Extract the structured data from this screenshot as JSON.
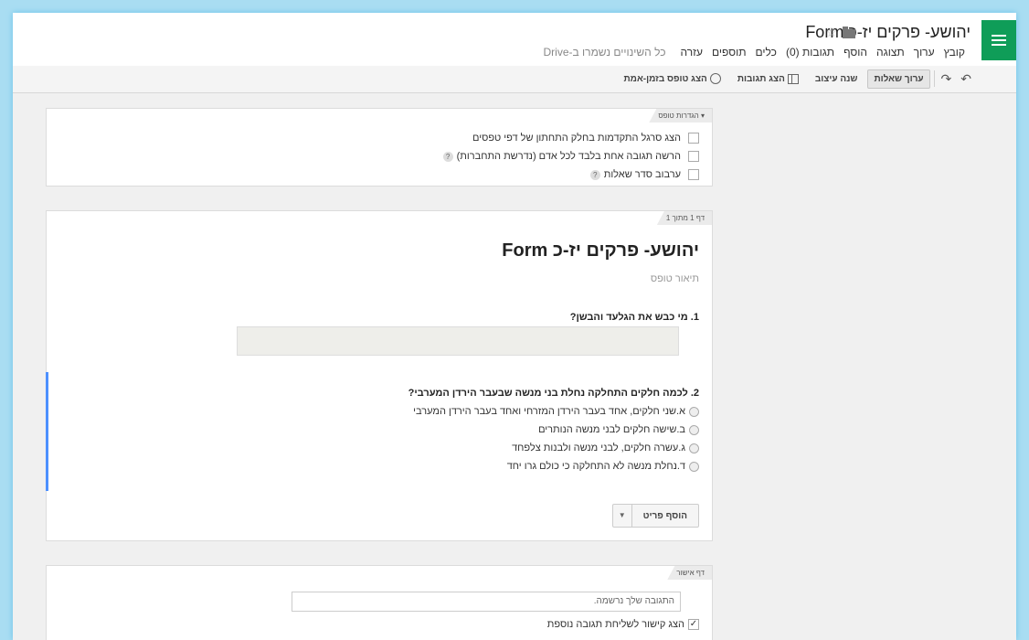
{
  "header": {
    "title": "יהושע- פרקים יז-כ Form",
    "menu": [
      "קובץ",
      "ערוך",
      "תצוגה",
      "הוסף",
      "תגובות (0)",
      "כלים",
      "תוספים",
      "עזרה"
    ],
    "saved_status": "כל השינויים נשמרו ב-Drive"
  },
  "toolbar": {
    "edit_questions": "ערוך שאלות",
    "change_theme": "שנה עיצוב",
    "view_responses": "הצג תגובות",
    "view_live_form": "הצג טופס בזמן-אמת"
  },
  "settings": {
    "label": "הגדרות טופס",
    "options": [
      "הצג סרגל התקדמות בחלק התחתון של דפי טפסים",
      "הרשה תגובה אחת בלבד לכל אדם (נדרשת התחברות)",
      "ערבוב סדר שאלות"
    ]
  },
  "page1": {
    "page_label": "דף 1 מתוך 1",
    "form_title": "יהושע- פרקים יז-כ Form",
    "form_description": "תיאור טופס",
    "q1": {
      "title": "1. מי כבש את הגלעד והבשן?"
    },
    "q2": {
      "title": "2. לכמה חלקים התחלקה נחלת בני מנשה שבעבר הירדן המערבי?",
      "options": [
        "א.שני חלקים, אחד בעבר הירדן המזרחי ואחד בעבר הירדן המערבי",
        "ב.שישה חלקים לבני מנשה הנותרים",
        "ג.עשרה חלקים, לבני מנשה ולבנות צלפחד",
        "ד.נחלת מנשה לא התחלקה כי כולם גרו יחד"
      ]
    },
    "add_item": "הוסף פריט"
  },
  "confirmation": {
    "page_label": "דף אישור",
    "response_text": "התגובה שלך נרשמה.",
    "link_option": "הצג קישור לשליחת תגובה נוספת"
  },
  "colors": {
    "brand": "#0f9d58",
    "selection": "#4d90fe"
  }
}
